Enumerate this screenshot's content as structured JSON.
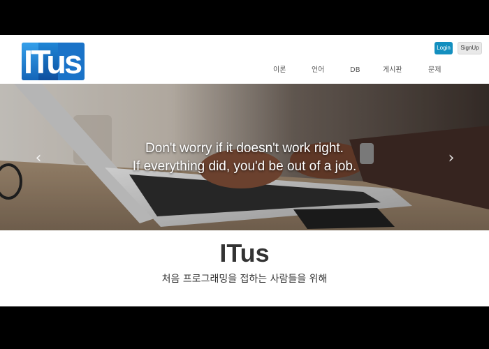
{
  "header": {
    "logo_text": "ITus",
    "auth": {
      "login_label": "Login",
      "signup_label": "SignUp"
    },
    "nav": [
      {
        "label": "이론"
      },
      {
        "label": "언어"
      },
      {
        "label": "DB"
      },
      {
        "label": "게시판"
      },
      {
        "label": "문제"
      }
    ]
  },
  "hero": {
    "caption_line1": "Don't worry if it doesn't work right.",
    "caption_line2": "If everything did, you'd be out of a job.",
    "prev_icon": "chevron-left-icon",
    "next_icon": "chevron-right-icon"
  },
  "main": {
    "title": "ITus",
    "subtitle": "처음 프로그래밍을 접하는 사람들을 위해"
  },
  "colors": {
    "brand": "#1a73c8",
    "login_button": "#138fbf",
    "text": "#333333"
  }
}
